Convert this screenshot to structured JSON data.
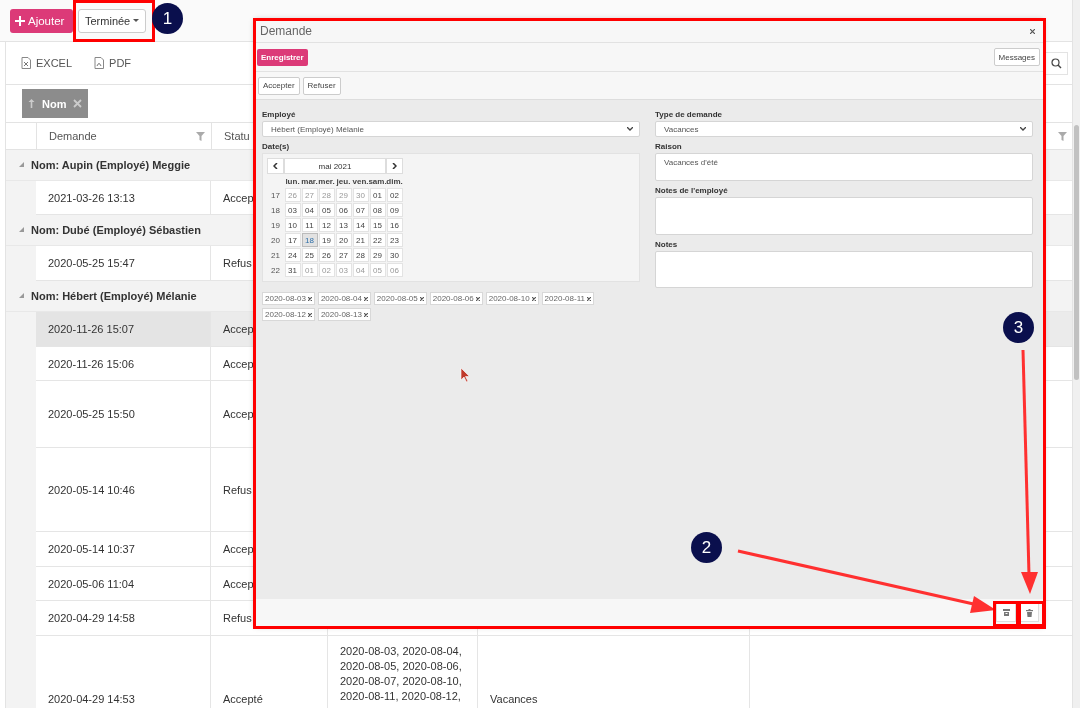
{
  "toolbar": {
    "add_button": "Ajouter",
    "status_filter": "Terminée"
  },
  "grid": {
    "exports": [
      {
        "label": "EXCEL",
        "kind": "excel"
      },
      {
        "label": "PDF",
        "kind": "pdf"
      }
    ],
    "group_chip": {
      "label": "Nom"
    },
    "columns": [
      {
        "label": "Demande",
        "filter_icon": true
      },
      {
        "label": "Statu"
      },
      {
        "filter_icon": true
      }
    ],
    "groups": [
      {
        "label": "Nom: Aupin (Employé) Meggie",
        "expanded": true,
        "rows": [
          {
            "cells": [
              "2021-03-26 13:13",
              "Accep"
            ],
            "selected": false
          }
        ]
      },
      {
        "label": "Nom: Dubé (Employé) Sébastien",
        "expanded": true,
        "rows": [
          {
            "cells": [
              "2020-05-25 15:47",
              "Refus"
            ],
            "selected": false
          }
        ]
      },
      {
        "label": "Nom: Hébert (Employé) Mélanie",
        "expanded": true,
        "rows": [
          {
            "cells": [
              "2020-11-26 15:07",
              "Accep"
            ],
            "selected": true
          },
          {
            "cells": [
              "2020-11-26 15:06",
              "Accep"
            ],
            "selected": false
          },
          {
            "cells": [
              "2020-05-25 15:50",
              "Accep"
            ],
            "selected": false
          },
          {
            "cells": [
              "2020-05-14 10:46",
              "Refus"
            ],
            "selected": false
          },
          {
            "cells": [
              "2020-05-14 10:37",
              "Accep"
            ],
            "selected": false
          },
          {
            "cells": [
              "2020-05-06 11:04",
              "Accep"
            ],
            "selected": false
          },
          {
            "cells": [
              "2020-04-29 14:58",
              "Refus"
            ],
            "selected": false
          },
          {
            "cells": [
              "2020-04-29 14:53",
              "Accepté",
              "2020-08-03, 2020-08-04, 2020-08-05, 2020-08-06, 2020-08-07, 2020-08-10, 2020-08-11, 2020-08-12,",
              "Vacances"
            ],
            "selected": false
          }
        ]
      }
    ]
  },
  "modal": {
    "title": "Demande",
    "save_button": "Enregistrer",
    "messages_button": "Messages",
    "actions": [
      "Accepter",
      "Refuser"
    ],
    "left": {
      "employee_label": "Employé",
      "employee_value": "Hébert (Employé) Mélanie",
      "dates_label": "Date(s)"
    },
    "calendar": {
      "month": "mai 2021",
      "weekdays": [
        "lun.",
        "mar.",
        "mer.",
        "jeu.",
        "ven.",
        "sam.",
        "dim."
      ],
      "weeks": [
        {
          "number": "17",
          "days": [
            {
              "label": "26",
              "muted": true,
              "selected": false
            },
            {
              "label": "27",
              "muted": true,
              "selected": false
            },
            {
              "label": "28",
              "muted": true,
              "selected": false
            },
            {
              "label": "29",
              "muted": true,
              "selected": false
            },
            {
              "label": "30",
              "muted": true,
              "selected": false
            },
            {
              "label": "01",
              "muted": false,
              "selected": false
            },
            {
              "label": "02",
              "muted": false,
              "selected": false
            }
          ]
        },
        {
          "number": "18",
          "days": [
            {
              "label": "03",
              "muted": false,
              "selected": false
            },
            {
              "label": "04",
              "muted": false,
              "selected": false
            },
            {
              "label": "05",
              "muted": false,
              "selected": false
            },
            {
              "label": "06",
              "muted": false,
              "selected": false
            },
            {
              "label": "07",
              "muted": false,
              "selected": false
            },
            {
              "label": "08",
              "muted": false,
              "selected": false
            },
            {
              "label": "09",
              "muted": false,
              "selected": false
            }
          ]
        },
        {
          "number": "19",
          "days": [
            {
              "label": "10",
              "muted": false,
              "selected": false
            },
            {
              "label": "11",
              "muted": false,
              "selected": false
            },
            {
              "label": "12",
              "muted": false,
              "selected": false
            },
            {
              "label": "13",
              "muted": false,
              "selected": false
            },
            {
              "label": "14",
              "muted": false,
              "selected": false
            },
            {
              "label": "15",
              "muted": false,
              "selected": false
            },
            {
              "label": "16",
              "muted": false,
              "selected": false
            }
          ]
        },
        {
          "number": "20",
          "days": [
            {
              "label": "17",
              "muted": false,
              "selected": false
            },
            {
              "label": "18",
              "muted": false,
              "selected": true
            },
            {
              "label": "19",
              "muted": false,
              "selected": false
            },
            {
              "label": "20",
              "muted": false,
              "selected": false
            },
            {
              "label": "21",
              "muted": false,
              "selected": false
            },
            {
              "label": "22",
              "muted": false,
              "selected": false
            },
            {
              "label": "23",
              "muted": false,
              "selected": false
            }
          ]
        },
        {
          "number": "21",
          "days": [
            {
              "label": "24",
              "muted": false,
              "selected": false
            },
            {
              "label": "25",
              "muted": false,
              "selected": false
            },
            {
              "label": "26",
              "muted": false,
              "selected": false
            },
            {
              "label": "27",
              "muted": false,
              "selected": false
            },
            {
              "label": "28",
              "muted": false,
              "selected": false
            },
            {
              "label": "29",
              "muted": false,
              "selected": false
            },
            {
              "label": "30",
              "muted": false,
              "selected": false
            }
          ]
        },
        {
          "number": "22",
          "days": [
            {
              "label": "31",
              "muted": false,
              "selected": false
            },
            {
              "label": "01",
              "muted": true,
              "selected": false
            },
            {
              "label": "02",
              "muted": true,
              "selected": false
            },
            {
              "label": "03",
              "muted": true,
              "selected": false
            },
            {
              "label": "04",
              "muted": true,
              "selected": false
            },
            {
              "label": "05",
              "muted": true,
              "selected": false
            },
            {
              "label": "06",
              "muted": true,
              "selected": false
            }
          ]
        }
      ]
    },
    "selected_dates": [
      "2020-08-03",
      "2020-08-04",
      "2020-08-05",
      "2020-08-06",
      "2020-08-10",
      "2020-08-11",
      "2020-08-12",
      "2020-08-13"
    ],
    "right": {
      "type_label": "Type de demande",
      "type_value": "Vacances",
      "reason_label": "Raison",
      "reason_value": "Vacances d'été",
      "employee_notes_label": "Notes de l'employé",
      "notes_label": "Notes"
    }
  },
  "callouts": [
    {
      "label": "1"
    },
    {
      "label": "2"
    },
    {
      "label": "3"
    }
  ]
}
